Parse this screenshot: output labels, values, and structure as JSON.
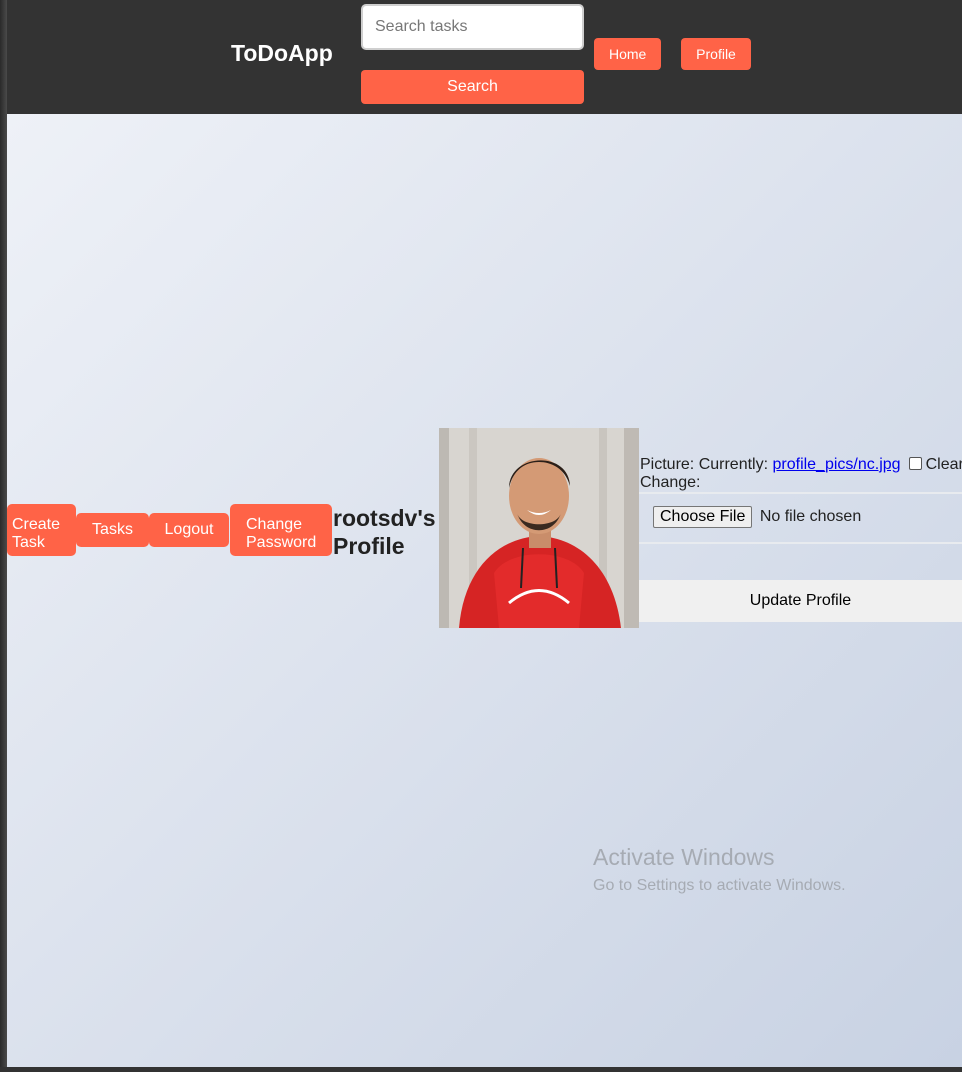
{
  "header": {
    "brand": "ToDoApp",
    "search_placeholder": "Search tasks",
    "search_button": "Search",
    "nav": {
      "home": "Home",
      "profile": "Profile"
    }
  },
  "sidebar": {
    "create_task": "Create Task",
    "tasks": "Tasks",
    "logout": "Logout",
    "change_password": "Change Password"
  },
  "profile": {
    "title": "rootsdv's Profile",
    "picture_label": "Picture: Currently:",
    "picture_link": "profile_pics/nc.jpg",
    "clear_label": "Clear",
    "change_label": "Change:",
    "choose_file": "Choose File",
    "no_file": "No file chosen",
    "update_button": "Update Profile"
  },
  "watermark": {
    "title": "Activate Windows",
    "subtitle": "Go to Settings to activate Windows."
  },
  "colors": {
    "accent": "#ff6347",
    "header_bg": "#333333",
    "link": "#0000ee"
  }
}
